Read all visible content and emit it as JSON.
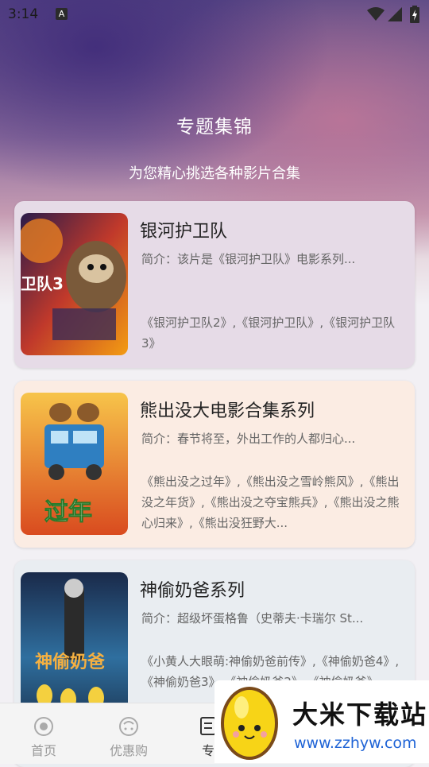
{
  "status_bar": {
    "time": "3:14",
    "notification_letter": "A"
  },
  "header": {
    "title": "专题集锦",
    "subtitle": "为您精心挑选各种影片合集"
  },
  "cards": [
    {
      "title": "银河护卫队",
      "desc": "简介：该片是《银河护卫队》电影系列...",
      "list": "《银河护卫队2》,《银河护卫队》,《银河护卫队3》",
      "poster_text": "卫队3"
    },
    {
      "title": "熊出没大电影合集系列",
      "desc": "简介：春节将至，外出工作的人都归心...",
      "list": "《熊出没之过年》,《熊出没之雪岭熊风》,《熊出没之年货》,《熊出没之夺宝熊兵》,《熊出没之熊心归来》,《熊出没狂野大...",
      "poster_text": "过年"
    },
    {
      "title": "神偷奶爸系列",
      "desc": "简介：超级坏蛋格鲁（史蒂夫·卡瑞尔 St...",
      "list": "《小黄人大眼萌:神偷奶爸前传》,《神偷奶爸4》,《神偷奶爸3》,《神偷奶爸2》,《神偷奶爸》",
      "poster_text": "神偷奶爸"
    }
  ],
  "tabbar": {
    "tabs": [
      {
        "label": "首页",
        "icon": "home-icon"
      },
      {
        "label": "优惠购",
        "icon": "discount-icon"
      },
      {
        "label": "专",
        "icon": "topic-icon"
      }
    ]
  },
  "watermark": {
    "title": "大米下载站",
    "url": "www.zzhyw.com"
  },
  "colors": {
    "card1_bg": "#e6dbe7",
    "card2_bg": "#fbece3",
    "card3_bg": "#e9edf1",
    "watermark_url": "#1e63d6"
  }
}
